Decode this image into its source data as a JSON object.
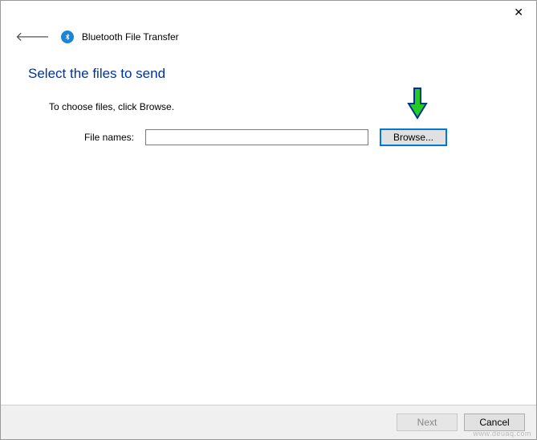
{
  "window": {
    "app_title": "Bluetooth File Transfer"
  },
  "main": {
    "heading": "Select the files to send",
    "instruction": "To choose files, click Browse.",
    "file_label": "File names:",
    "file_value": "",
    "browse_label": "Browse..."
  },
  "footer": {
    "next_label": "Next",
    "cancel_label": "Cancel"
  },
  "watermark": "www.deuaq.com"
}
